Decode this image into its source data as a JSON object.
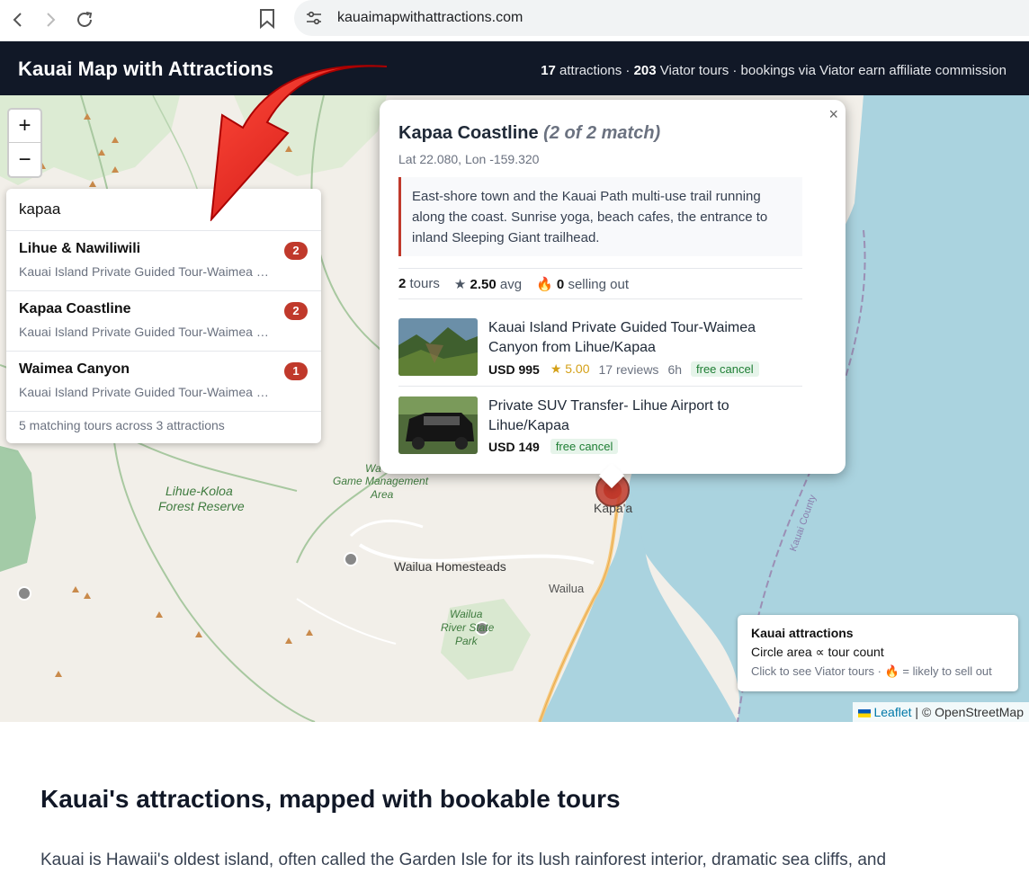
{
  "browser": {
    "url": "kauaimapwithattractions.com"
  },
  "header": {
    "title": "Kauai Map with Attractions",
    "attractions_count": "17",
    "attractions_label": "attractions ·",
    "tours_count": "203",
    "tours_label": "Viator tours · bookings via Viator earn affiliate commission"
  },
  "map": {
    "zoom_in": "+",
    "zoom_out": "−",
    "labels": {
      "forest_reserve_1": "Lihue-Koloa",
      "forest_reserve_2": "Forest Reserve",
      "game_area_1": "Wa",
      "game_area_2": "Game Management",
      "game_area_3": "Area",
      "wailua_homesteads": "Wailua Homesteads",
      "wailua": "Wailua",
      "kapaa": "Kapa'a",
      "park_1": "Wailua",
      "park_2": "River State",
      "park_3": "Park",
      "kauai_county": "Kauai County"
    },
    "attribution_leaflet": "Leaflet",
    "attribution_osm": "| © OpenStreetMap"
  },
  "search": {
    "query": "kapaa",
    "results": [
      {
        "name": "Lihue & Nawiliwili",
        "sub": "Kauai Island Private Guided Tour-Waimea Canyon from Lihue/Kapaa",
        "count": "2"
      },
      {
        "name": "Kapaa Coastline",
        "sub": "Kauai Island Private Guided Tour-Waimea Canyon from Lihue/Kapaa",
        "count": "2"
      },
      {
        "name": "Waimea Canyon",
        "sub": "Kauai Island Private Guided Tour-Waimea Canyon from Lihue/Kapaa",
        "count": "1"
      }
    ],
    "footer": "5 matching tours across 3 attractions"
  },
  "popup": {
    "close": "×",
    "title": "Kapaa Coastline",
    "match": "(2 of 2 match)",
    "coords": "Lat 22.080, Lon -159.320",
    "description": "East-shore town and the Kauai Path multi-use trail running along the coast. Sunrise yoga, beach cafes, the entrance to inland Sleeping Giant trailhead.",
    "tours_count": "2",
    "tours_label": "tours",
    "avg_rating": "2.50",
    "avg_label": "avg",
    "selling_out_count": "0",
    "selling_out_label": "selling out",
    "tours": [
      {
        "name": "Kauai Island Private Guided Tour-Waimea Canyon from Lihue/Kapaa",
        "price": "USD 995",
        "rating": "★ 5.00",
        "reviews": "17 reviews",
        "duration": "6h",
        "cancel": "free cancel"
      },
      {
        "name": "Private SUV Transfer- Lihue Airport to Lihue/Kapaa",
        "price": "USD 149",
        "cancel": "free cancel"
      }
    ]
  },
  "legend": {
    "title": "Kauai attractions",
    "line1": "Circle area ∝ tour count",
    "line2a": "Click to see Viator tours ·",
    "line2b": "= likely to sell out"
  },
  "article": {
    "heading": "Kauai's attractions, mapped with bookable tours",
    "paragraph": "Kauai is Hawaii's oldest island, often called the Garden Isle for its lush rainforest interior, dramatic sea cliffs, and"
  },
  "colors": {
    "header_bg": "#111827",
    "accent_red": "#c0392b",
    "ocean": "#aad3df",
    "land": "#f2efe9"
  }
}
